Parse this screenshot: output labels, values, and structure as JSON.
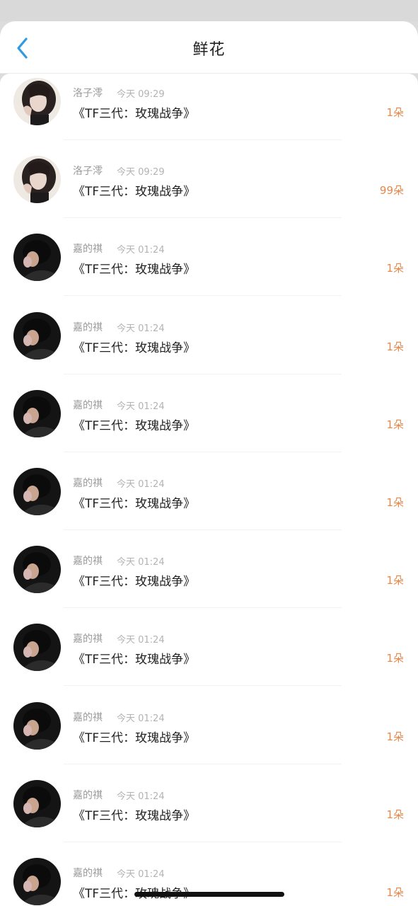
{
  "header": {
    "title": "鲜花",
    "accent": "#2f9ae0"
  },
  "gifts": [
    {
      "sender": "洛子澪",
      "time": "今天 09:29",
      "title": "《TF三代：玫瑰战争》",
      "count": "1朵",
      "avatar": "girl"
    },
    {
      "sender": "洛子澪",
      "time": "今天 09:29",
      "title": "《TF三代：玫瑰战争》",
      "count": "99朵",
      "avatar": "girl"
    },
    {
      "sender": "嘉的祺",
      "time": "今天 01:24",
      "title": "《TF三代：玫瑰战争》",
      "count": "1朵",
      "avatar": "boy"
    },
    {
      "sender": "嘉的祺",
      "time": "今天 01:24",
      "title": "《TF三代：玫瑰战争》",
      "count": "1朵",
      "avatar": "boy"
    },
    {
      "sender": "嘉的祺",
      "time": "今天 01:24",
      "title": "《TF三代：玫瑰战争》",
      "count": "1朵",
      "avatar": "boy"
    },
    {
      "sender": "嘉的祺",
      "time": "今天 01:24",
      "title": "《TF三代：玫瑰战争》",
      "count": "1朵",
      "avatar": "boy"
    },
    {
      "sender": "嘉的祺",
      "time": "今天 01:24",
      "title": "《TF三代：玫瑰战争》",
      "count": "1朵",
      "avatar": "boy"
    },
    {
      "sender": "嘉的祺",
      "time": "今天 01:24",
      "title": "《TF三代：玫瑰战争》",
      "count": "1朵",
      "avatar": "boy"
    },
    {
      "sender": "嘉的祺",
      "time": "今天 01:24",
      "title": "《TF三代：玫瑰战争》",
      "count": "1朵",
      "avatar": "boy"
    },
    {
      "sender": "嘉的祺",
      "time": "今天 01:24",
      "title": "《TF三代：玫瑰战争》",
      "count": "1朵",
      "avatar": "boy"
    },
    {
      "sender": "嘉的祺",
      "time": "今天 01:24",
      "title": "《TF三代：玫瑰战争》",
      "count": "1朵",
      "avatar": "boy"
    }
  ],
  "colors": {
    "count": "#e8874a",
    "name": "#9a9a9a",
    "time": "#b3b3b3"
  }
}
